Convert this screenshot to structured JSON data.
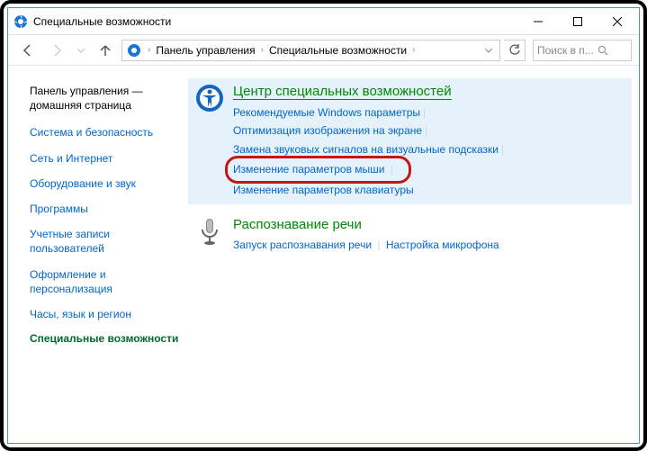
{
  "window": {
    "title": "Специальные возможности"
  },
  "breadcrumb": {
    "item1": "Панель управления",
    "item2": "Специальные возможности"
  },
  "search": {
    "placeholder": "Поиск в п..."
  },
  "sidebar": {
    "header": "Панель управления — домашняя страница",
    "items": [
      "Система и безопасность",
      "Сеть и Интернет",
      "Оборудование и звук",
      "Программы",
      "Учетные записи пользователей",
      "Оформление и персонализация",
      "Часы, язык и регион"
    ],
    "active": "Специальные возможности"
  },
  "sections": {
    "ease": {
      "title": "Центр специальных возможностей",
      "links": {
        "rec": "Рекомендуемые Windows параметры",
        "opt": "Оптимизация изображения на экране",
        "sound": "Замена звуковых сигналов на визуальные подсказки",
        "mouse": "Изменение параметров мыши",
        "keyb": "Изменение параметров клавиатуры"
      }
    },
    "speech": {
      "title": "Распознавание речи",
      "links": {
        "start": "Запуск распознавания речи",
        "mic": "Настройка микрофона"
      }
    }
  }
}
